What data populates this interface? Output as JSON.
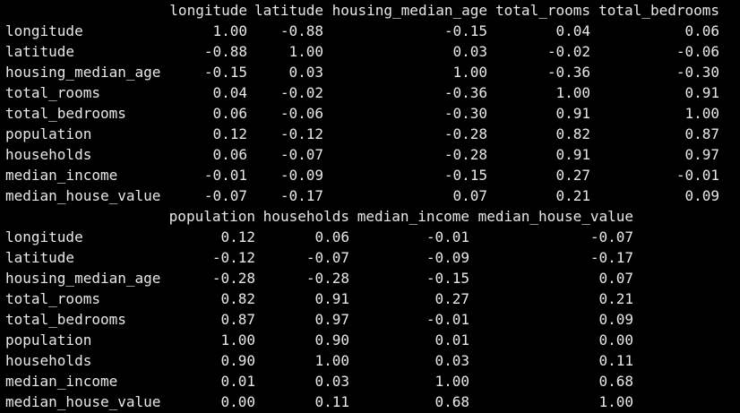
{
  "colors": {
    "background": "#000000",
    "text": "#e8e8e8"
  },
  "tables": [
    {
      "columns": [
        "longitude",
        "latitude",
        "housing_median_age",
        "total_rooms",
        "total_bedrooms"
      ],
      "rows": [
        {
          "label": "longitude",
          "values": [
            "1.00",
            "-0.88",
            "-0.15",
            "0.04",
            "0.06"
          ]
        },
        {
          "label": "latitude",
          "values": [
            "-0.88",
            "1.00",
            "0.03",
            "-0.02",
            "-0.06"
          ]
        },
        {
          "label": "housing_median_age",
          "values": [
            "-0.15",
            "0.03",
            "1.00",
            "-0.36",
            "-0.30"
          ]
        },
        {
          "label": "total_rooms",
          "values": [
            "0.04",
            "-0.02",
            "-0.36",
            "1.00",
            "0.91"
          ]
        },
        {
          "label": "total_bedrooms",
          "values": [
            "0.06",
            "-0.06",
            "-0.30",
            "0.91",
            "1.00"
          ]
        },
        {
          "label": "population",
          "values": [
            "0.12",
            "-0.12",
            "-0.28",
            "0.82",
            "0.87"
          ]
        },
        {
          "label": "households",
          "values": [
            "0.06",
            "-0.07",
            "-0.28",
            "0.91",
            "0.97"
          ]
        },
        {
          "label": "median_income",
          "values": [
            "-0.01",
            "-0.09",
            "-0.15",
            "0.27",
            "-0.01"
          ]
        },
        {
          "label": "median_house_value",
          "values": [
            "-0.07",
            "-0.17",
            "0.07",
            "0.21",
            "0.09"
          ]
        }
      ]
    },
    {
      "columns": [
        "population",
        "households",
        "median_income",
        "median_house_value"
      ],
      "rows": [
        {
          "label": "longitude",
          "values": [
            "0.12",
            "0.06",
            "-0.01",
            "-0.07"
          ]
        },
        {
          "label": "latitude",
          "values": [
            "-0.12",
            "-0.07",
            "-0.09",
            "-0.17"
          ]
        },
        {
          "label": "housing_median_age",
          "values": [
            "-0.28",
            "-0.28",
            "-0.15",
            "0.07"
          ]
        },
        {
          "label": "total_rooms",
          "values": [
            "0.82",
            "0.91",
            "0.27",
            "0.21"
          ]
        },
        {
          "label": "total_bedrooms",
          "values": [
            "0.87",
            "0.97",
            "-0.01",
            "0.09"
          ]
        },
        {
          "label": "population",
          "values": [
            "1.00",
            "0.90",
            "0.01",
            "0.00"
          ]
        },
        {
          "label": "households",
          "values": [
            "0.90",
            "1.00",
            "0.03",
            "0.11"
          ]
        },
        {
          "label": "median_income",
          "values": [
            "0.01",
            "0.03",
            "1.00",
            "0.68"
          ]
        },
        {
          "label": "median_house_value",
          "values": [
            "0.00",
            "0.11",
            "0.68",
            "1.00"
          ]
        }
      ]
    }
  ]
}
